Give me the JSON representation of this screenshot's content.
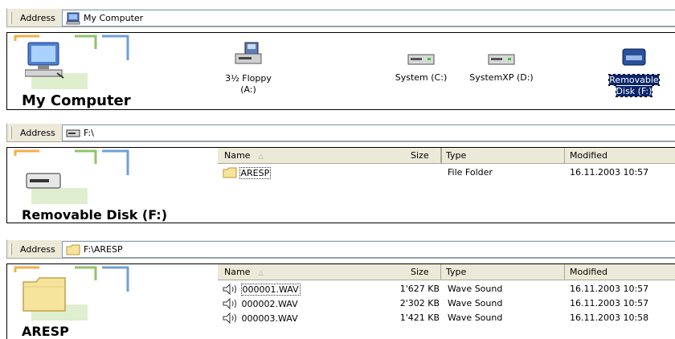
{
  "panels": [
    {
      "address_label": "Address",
      "address_value": "My Computer",
      "view_title": "My Computer",
      "drives": [
        {
          "label_line1": "3½ Floppy",
          "label_line2": "(A:)",
          "icon": "floppy-drive-icon"
        },
        {
          "label_line1": "System (C:)",
          "label_line2": "",
          "icon": "hard-drive-icon"
        },
        {
          "label_line1": "SystemXP (D:)",
          "label_line2": "",
          "icon": "hard-drive-icon"
        },
        {
          "label_line1": "Removable",
          "label_line2": "Disk (F:)",
          "icon": "removable-disk-icon",
          "selected": true
        }
      ]
    },
    {
      "address_label": "Address",
      "address_value": "F:\\",
      "view_title": "Removable Disk (F:)",
      "columns": {
        "name": "Name",
        "size": "Size",
        "type": "Type",
        "modified": "Modified"
      },
      "rows": [
        {
          "name": "ARESP",
          "size": "",
          "type": "File Folder",
          "modified": "16.11.2003 10:57",
          "icon": "folder-icon"
        }
      ]
    },
    {
      "address_label": "Address",
      "address_value": "F:\\ARESP",
      "view_title": "ARESP",
      "columns": {
        "name": "Name",
        "size": "Size",
        "type": "Type",
        "modified": "Modified"
      },
      "rows": [
        {
          "name": "000001.WAV",
          "size": "1'627 KB",
          "type": "Wave Sound",
          "modified": "16.11.2003 10:57",
          "icon": "speaker-icon"
        },
        {
          "name": "000002.WAV",
          "size": "2'302 KB",
          "type": "Wave Sound",
          "modified": "16.11.2003 10:57",
          "icon": "speaker-icon"
        },
        {
          "name": "000003.WAV",
          "size": "1'421 KB",
          "type": "Wave Sound",
          "modified": "16.11.2003 10:58",
          "icon": "speaker-icon"
        }
      ]
    }
  ],
  "colors": {
    "selection": "#0a246a",
    "toolbar": "#ece9d8",
    "folder": "#f6e39c"
  }
}
